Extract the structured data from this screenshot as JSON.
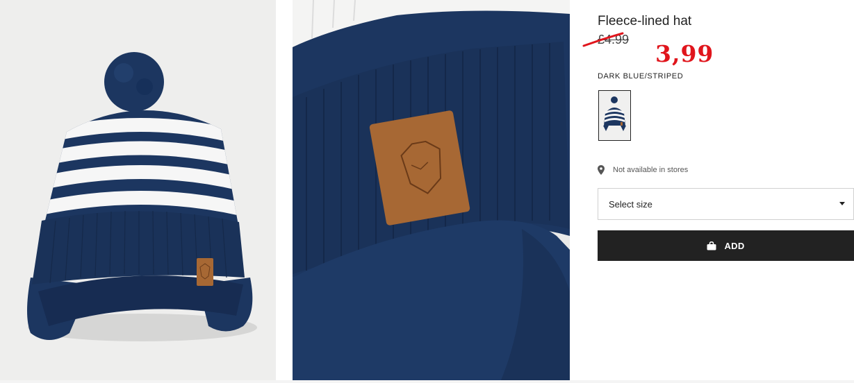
{
  "product": {
    "title": "Fleece-lined hat",
    "old_price": "£4.99",
    "new_price": "3,99",
    "color_name": "DARK BLUE/STRIPED",
    "store_availability": "Not available in stores",
    "size_placeholder": "Select size",
    "add_label": "ADD"
  },
  "images": [
    {
      "name": "hat-full-image"
    },
    {
      "name": "hat-detail-image"
    }
  ],
  "icons": {
    "location": "location-pin-icon",
    "dropdown": "chevron-down-icon",
    "bag": "shopping-bag-icon"
  },
  "colors": {
    "navy": "#1c3660",
    "stripe": "#f6f6f6",
    "leather": "#a76834",
    "sale_red": "#e0151c",
    "button_dark": "#222222"
  }
}
